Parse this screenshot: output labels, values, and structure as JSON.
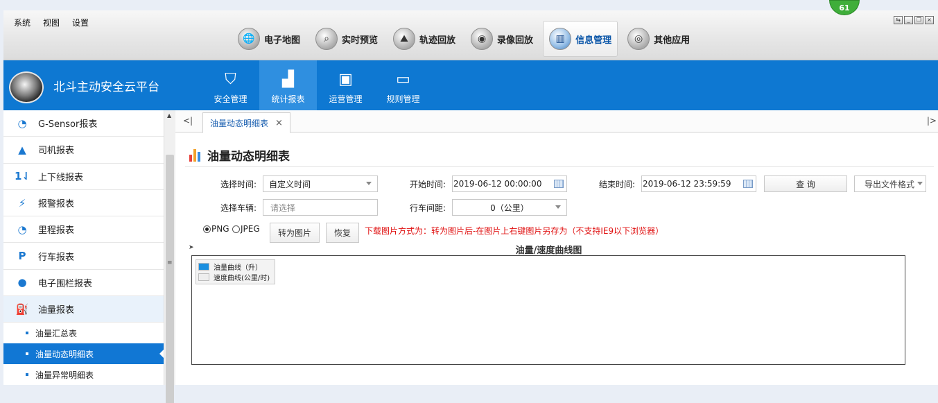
{
  "system_menu": [
    "系统",
    "视图",
    "设置"
  ],
  "modules": [
    {
      "label": "电子地图",
      "icon": "map-globe-icon"
    },
    {
      "label": "实时预览",
      "icon": "magnifier-icon"
    },
    {
      "label": "轨迹回放",
      "icon": "track-icon"
    },
    {
      "label": "录像回放",
      "icon": "video-reel-icon"
    },
    {
      "label": "信息管理",
      "icon": "info-chart-icon",
      "active": true
    },
    {
      "label": "其他应用",
      "icon": "app-disc-icon"
    }
  ],
  "notification_count": "61",
  "platform_name": "北斗主动安全云平台",
  "nav_tabs": [
    {
      "label": "安全管理",
      "icon": "shield-play-icon"
    },
    {
      "label": "统计报表",
      "icon": "bar-chart-icon",
      "active": true
    },
    {
      "label": "运营管理",
      "icon": "device-icon"
    },
    {
      "label": "规则管理",
      "icon": "stack-icon"
    }
  ],
  "sidebar": {
    "items": [
      {
        "label": "G-Sensor报表",
        "icon": "gauge-icon"
      },
      {
        "label": "司机报表",
        "icon": "warning-triangle-icon"
      },
      {
        "label": "上下线报表",
        "icon": "online-offline-icon"
      },
      {
        "label": "报警报表",
        "icon": "alarm-icon"
      },
      {
        "label": "里程报表",
        "icon": "speedometer-icon"
      },
      {
        "label": "行车报表",
        "icon": "parking-p-icon"
      },
      {
        "label": "电子围栏报表",
        "icon": "location-pin-icon"
      },
      {
        "label": "油量报表",
        "icon": "fuel-pump-icon",
        "open": true
      }
    ],
    "subitems": [
      {
        "label": "油量汇总表"
      },
      {
        "label": "油量动态明细表",
        "active": true
      },
      {
        "label": "油量异常明细表"
      }
    ]
  },
  "content": {
    "tab_label": "油量动态明细表",
    "page_title": "油量动态明细表",
    "filters": {
      "time_label": "选择时间:",
      "time_value": "自定义时间",
      "start_label": "开始时间:",
      "start_value": "2019-06-12 00:00:00",
      "end_label": "结束时间:",
      "end_value": "2019-06-12 23:59:59",
      "query_button": "查 询",
      "export_button": "导出文件格式",
      "vehicle_label": "选择车辆:",
      "vehicle_placeholder": "请选择",
      "interval_label": "行车间距:",
      "interval_value": "0（公里）"
    },
    "image_options": {
      "png_label": "PNG",
      "jpeg_label": "JPEG",
      "selected": "PNG",
      "convert_button": "转为图片",
      "restore_button": "恢复",
      "hint": "下载图片方式为：转为图片后-在图片上右键图片另存为（不支持IE9以下浏览器）"
    },
    "chart": {
      "title": "油量/速度曲线图",
      "legend": [
        {
          "name": "油量曲线（升）",
          "color": "#1a8fe0"
        },
        {
          "name": "速度曲线(公里/时)",
          "color": "#eeeeee"
        }
      ]
    }
  },
  "colors": {
    "brand_blue": "#0e78d2",
    "active_tab_blue": "#2f8fe0",
    "hint_red": "#e01010",
    "badge_green": "#3fae3a"
  }
}
